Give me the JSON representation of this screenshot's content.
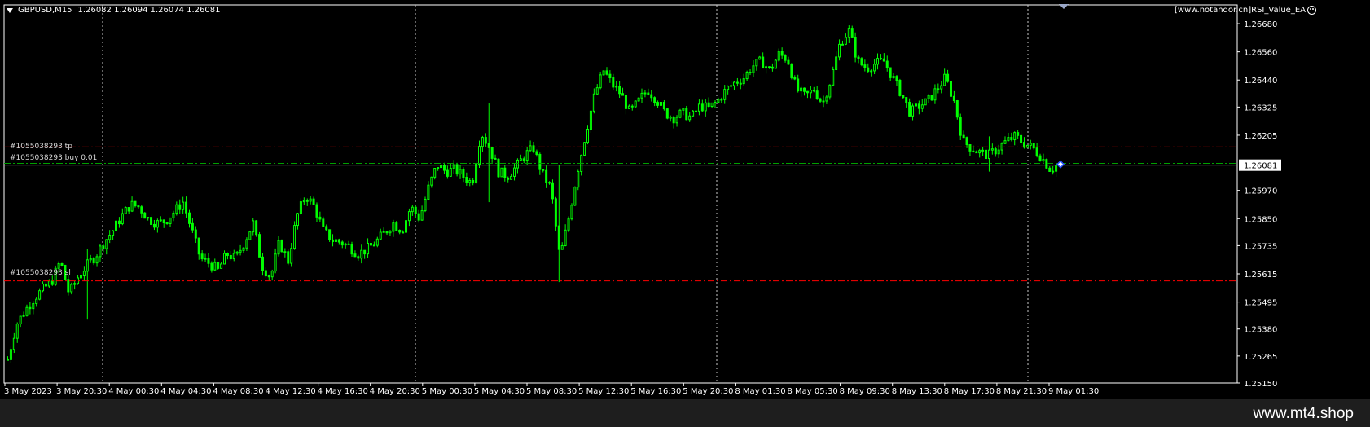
{
  "header": {
    "symbol_timeframe": "GBPUSD,M15",
    "ohlc": "1.26082 1.26094 1.26074 1.26081"
  },
  "ea_label": "[www.notandor.cn]RSI_Value_EA",
  "orders": {
    "tp_label": "#1055038293 tp",
    "buy_label": "#1055038293 buy 0.01",
    "sl_label": "#1055038293 sl",
    "tp_price": 1.26155,
    "entry_price": 1.26085,
    "sl_price": 1.25585
  },
  "footer": {
    "brand": "www.mt4.shop"
  },
  "colors": {
    "background": "#000000",
    "candle": "#00ff00",
    "grid": "#c8c8c8",
    "tp_sl_line": "#ff0000",
    "entry_line": "#00a000",
    "current_price_line": "#a0a0a0"
  },
  "chart_data": {
    "type": "candlestick",
    "symbol": "GBPUSD",
    "timeframe": "M15",
    "ylim": [
      1.2515,
      1.2676
    ],
    "current_price": 1.26081,
    "current_price_label": "1.26081",
    "y_ticks": [
      "1.26680",
      "1.26560",
      "1.26440",
      "1.26325",
      "1.26205",
      "1.25970",
      "1.25850",
      "1.25735",
      "1.25615",
      "1.25495",
      "1.25380",
      "1.25265",
      "1.25150"
    ],
    "x_ticks": [
      "3 May 2023",
      "3 May 20:30",
      "4 May 00:30",
      "4 May 04:30",
      "4 May 08:30",
      "4 May 12:30",
      "4 May 16:30",
      "4 May 20:30",
      "5 May 00:30",
      "5 May 04:30",
      "5 May 08:30",
      "5 May 12:30",
      "5 May 16:30",
      "5 May 20:30",
      "8 May 01:30",
      "8 May 05:30",
      "8 May 09:30",
      "8 May 13:30",
      "8 May 17:30",
      "8 May 21:30",
      "9 May 01:30"
    ],
    "close_path": [
      [
        0,
        1.2525
      ],
      [
        2,
        1.254
      ],
      [
        4,
        1.2546
      ],
      [
        6,
        1.2551
      ],
      [
        8,
        1.2555
      ],
      [
        10,
        1.2558
      ],
      [
        12,
        1.2567
      ],
      [
        14,
        1.2553
      ],
      [
        16,
        1.256
      ],
      [
        18,
        1.2565
      ],
      [
        20,
        1.2569
      ],
      [
        22,
        1.2575
      ],
      [
        24,
        1.258
      ],
      [
        26,
        1.2586
      ],
      [
        28,
        1.2591
      ],
      [
        30,
        1.259
      ],
      [
        32,
        1.2585
      ],
      [
        34,
        1.2583
      ],
      [
        36,
        1.2584
      ],
      [
        38,
        1.2588
      ],
      [
        40,
        1.2592
      ],
      [
        42,
        1.258
      ],
      [
        44,
        1.2568
      ],
      [
        46,
        1.2566
      ],
      [
        48,
        1.2563
      ],
      [
        50,
        1.257
      ],
      [
        52,
        1.2568
      ],
      [
        54,
        1.2575
      ],
      [
        56,
        1.2583
      ],
      [
        58,
        1.2565
      ],
      [
        60,
        1.256
      ],
      [
        62,
        1.2575
      ],
      [
        64,
        1.2567
      ],
      [
        66,
        1.2586
      ],
      [
        68,
        1.2595
      ],
      [
        70,
        1.259
      ],
      [
        72,
        1.258
      ],
      [
        74,
        1.2576
      ],
      [
        76,
        1.2575
      ],
      [
        78,
        1.2573
      ],
      [
        80,
        1.257
      ],
      [
        82,
        1.2572
      ],
      [
        84,
        1.2575
      ],
      [
        86,
        1.2579
      ],
      [
        88,
        1.2583
      ],
      [
        90,
        1.258
      ],
      [
        92,
        1.259
      ],
      [
        94,
        1.2585
      ],
      [
        96,
        1.2598
      ],
      [
        98,
        1.2608
      ],
      [
        100,
        1.2605
      ],
      [
        102,
        1.2606
      ],
      [
        104,
        1.2603
      ],
      [
        106,
        1.26
      ],
      [
        108,
        1.2622
      ],
      [
        110,
        1.2615
      ],
      [
        112,
        1.2605
      ],
      [
        114,
        1.2603
      ],
      [
        116,
        1.2607
      ],
      [
        118,
        1.2612
      ],
      [
        120,
        1.2615
      ],
      [
        122,
        1.2604
      ],
      [
        124,
        1.2598
      ],
      [
        126,
        1.2568
      ],
      [
        128,
        1.2585
      ],
      [
        130,
        1.2605
      ],
      [
        132,
        1.2622
      ],
      [
        134,
        1.2638
      ],
      [
        136,
        1.2648
      ],
      [
        138,
        1.2642
      ],
      [
        140,
        1.2638
      ],
      [
        142,
        1.263
      ],
      [
        144,
        1.2635
      ],
      [
        146,
        1.264
      ],
      [
        148,
        1.2636
      ],
      [
        150,
        1.263
      ],
      [
        152,
        1.2628
      ],
      [
        154,
        1.263
      ],
      [
        156,
        1.2628
      ],
      [
        158,
        1.2633
      ],
      [
        160,
        1.2632
      ],
      [
        162,
        1.2635
      ],
      [
        164,
        1.264
      ],
      [
        166,
        1.2643
      ],
      [
        168,
        1.2645
      ],
      [
        170,
        1.265
      ],
      [
        172,
        1.2652
      ],
      [
        174,
        1.2648
      ],
      [
        176,
        1.2655
      ],
      [
        178,
        1.2653
      ],
      [
        180,
        1.264
      ],
      [
        182,
        1.2637
      ],
      [
        184,
        1.264
      ],
      [
        186,
        1.2634
      ],
      [
        188,
        1.2645
      ],
      [
        190,
        1.266
      ],
      [
        192,
        1.2665
      ],
      [
        194,
        1.2652
      ],
      [
        196,
        1.2649
      ],
      [
        198,
        1.2651
      ],
      [
        200,
        1.2652
      ],
      [
        202,
        1.2645
      ],
      [
        204,
        1.2638
      ],
      [
        206,
        1.263
      ],
      [
        208,
        1.2633
      ],
      [
        210,
        1.2635
      ],
      [
        212,
        1.264
      ],
      [
        214,
        1.2645
      ],
      [
        216,
        1.2635
      ],
      [
        218,
        1.2618
      ],
      [
        220,
        1.2615
      ],
      [
        222,
        1.2613
      ],
      [
        224,
        1.2612
      ],
      [
        226,
        1.2615
      ],
      [
        228,
        1.2618
      ],
      [
        230,
        1.262
      ],
      [
        232,
        1.2617
      ],
      [
        234,
        1.2615
      ],
      [
        236,
        1.2611
      ],
      [
        238,
        1.2606
      ],
      [
        240,
        1.26081
      ]
    ],
    "spikes": [
      [
        18,
        1.2572,
        1.2542
      ],
      [
        110,
        1.2634,
        1.2592
      ],
      [
        126,
        1.2608,
        1.2558
      ],
      [
        224,
        1.262,
        1.2605
      ],
      [
        240,
        1.2612,
        1.2603
      ]
    ]
  }
}
